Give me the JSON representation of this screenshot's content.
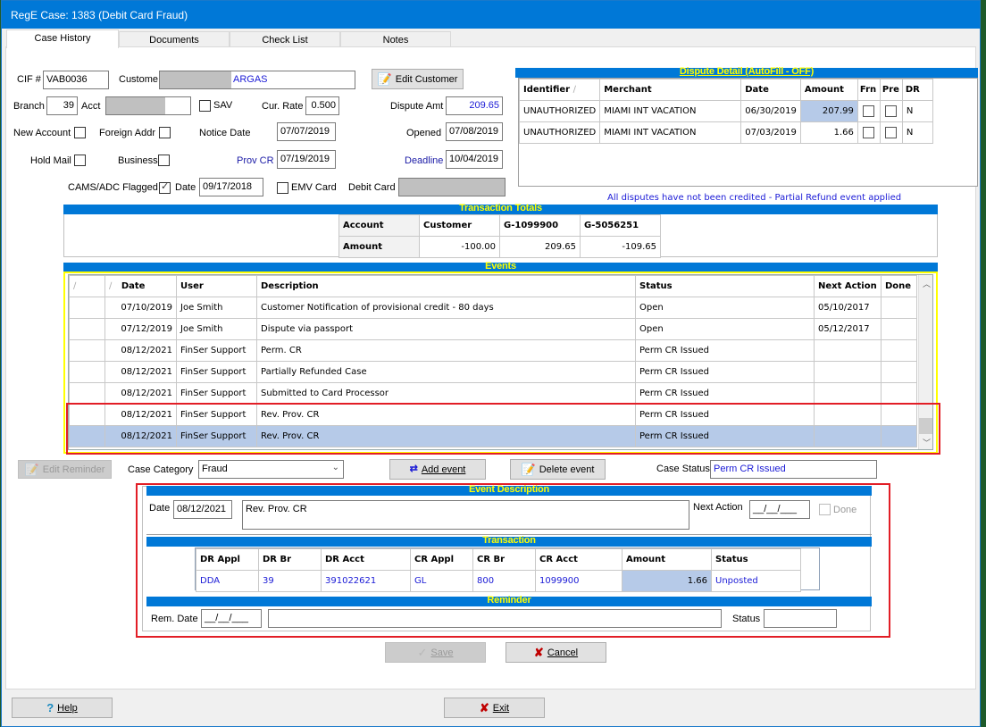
{
  "window": {
    "title": "RegE Case: 1383 (Debit Card Fraud)"
  },
  "tabs": [
    {
      "label": "Case History",
      "active": true
    },
    {
      "label": "Documents",
      "active": false
    },
    {
      "label": "Check List",
      "active": false
    },
    {
      "label": "Notes",
      "active": false
    }
  ],
  "case": {
    "cif_label": "CIF #",
    "cif": "VAB0036",
    "customer_label": "Custome",
    "customer_visible": "ARGAS",
    "edit_customer": "Edit Customer",
    "branch_label": "Branch",
    "branch": "39",
    "acct_label": "Acct",
    "sav_label": "SAV",
    "sav_checked": false,
    "cur_rate_label": "Cur. Rate",
    "cur_rate": "0.500",
    "dispute_amt_label": "Dispute Amt",
    "dispute_amt": "209.65",
    "new_account_label": "New Account",
    "new_account_checked": false,
    "foreign_addr_label": "Foreign Addr",
    "foreign_addr_checked": false,
    "notice_date_label": "Notice Date",
    "notice_date": "07/07/2019",
    "opened_label": "Opened",
    "opened": "07/08/2019",
    "hold_mail_label": "Hold Mail",
    "hold_mail_checked": false,
    "business_label": "Business",
    "business_checked": false,
    "prov_cr_label": "Prov CR",
    "prov_cr": "07/19/2019",
    "deadline_label": "Deadline",
    "deadline": "10/04/2019",
    "cams_label": "CAMS/ADC Flagged",
    "cams_checked": true,
    "date_label": "Date",
    "cams_date": "09/17/2018",
    "emv_label": "EMV Card",
    "emv_checked": false,
    "debit_card_label": "Debit Card"
  },
  "dispute_detail": {
    "title": "Dispute Detail (AutoFill - OFF)",
    "columns": [
      "Identifier",
      "Merchant",
      "Date",
      "Amount",
      "Frn",
      "Pre",
      "DR"
    ],
    "rows": [
      {
        "identifier": "UNAUTHORIZED",
        "merchant": "MIAMI INT VACATION",
        "date": "06/30/2019",
        "amount": "207.99",
        "frn": false,
        "pre": false,
        "dr": "N"
      },
      {
        "identifier": "UNAUTHORIZED",
        "merchant": "MIAMI INT VACATION",
        "date": "07/03/2019",
        "amount": "1.66",
        "frn": false,
        "pre": false,
        "dr": "N"
      }
    ],
    "note": "All disputes have not been credited - Partial Refund event applied"
  },
  "transaction_totals": {
    "title": "Transaction Totals",
    "columns": [
      "Account",
      "Customer",
      "G-1099900",
      "G-5056251"
    ],
    "row_label": "Amount",
    "values": [
      "-100.00",
      "209.65",
      "-109.65"
    ]
  },
  "events": {
    "title": "Events",
    "columns": [
      "",
      "Date",
      "User",
      "Description",
      "Status",
      "Next Action",
      "Done"
    ],
    "rows": [
      {
        "date": "07/10/2019",
        "user": "Joe Smith",
        "description": "Customer Notification of provisional credit - 80 days",
        "status": "Open",
        "next_action": "05/10/2017",
        "done": ""
      },
      {
        "date": "07/12/2019",
        "user": "Joe Smith",
        "description": "Dispute via passport",
        "status": "Open",
        "next_action": "05/12/2017",
        "done": ""
      },
      {
        "date": "08/12/2021",
        "user": "FinSer Support",
        "description": "Perm. CR",
        "status": "Perm CR Issued",
        "next_action": "",
        "done": ""
      },
      {
        "date": "08/12/2021",
        "user": "FinSer Support",
        "description": "Partially Refunded Case",
        "status": "Perm CR Issued",
        "next_action": "",
        "done": ""
      },
      {
        "date": "08/12/2021",
        "user": "FinSer Support",
        "description": "Submitted to Card Processor",
        "status": "Perm CR Issued",
        "next_action": "",
        "done": ""
      },
      {
        "date": "08/12/2021",
        "user": "FinSer Support",
        "description": "Rev. Prov. CR",
        "status": "Perm CR Issued",
        "next_action": "",
        "done": ""
      },
      {
        "date": "08/12/2021",
        "user": "FinSer Support",
        "description": "Rev. Prov. CR",
        "status": "Perm CR Issued",
        "next_action": "",
        "done": "",
        "selected": true
      }
    ]
  },
  "actions": {
    "edit_reminder": "Edit Reminder",
    "case_category_label": "Case Category",
    "case_category": "Fraud",
    "add_event": "Add event",
    "delete_event": "Delete event",
    "case_status_label": "Case Status",
    "case_status": "Perm CR Issued"
  },
  "event_description": {
    "title": "Event Description",
    "date_label": "Date",
    "date": "08/12/2021",
    "description": "Rev. Prov. CR",
    "next_action_label": "Next Action",
    "next_action": "__/__/___",
    "done_label": "Done",
    "done_checked": false
  },
  "transaction": {
    "title": "Transaction",
    "columns": [
      "DR Appl",
      "DR Br",
      "DR Acct",
      "CR Appl",
      "CR Br",
      "CR Acct",
      "Amount",
      "Status"
    ],
    "rows": [
      {
        "dr_appl": "DDA",
        "dr_br": "39",
        "dr_acct": "391022621",
        "cr_appl": "GL",
        "cr_br": "800",
        "cr_acct": "1099900",
        "amount": "1.66",
        "status": "Unposted"
      }
    ]
  },
  "reminder": {
    "title": "Reminder",
    "rem_date_label": "Rem. Date",
    "rem_date": "__/__/___",
    "text": "",
    "status_label": "Status",
    "status": ""
  },
  "footer": {
    "save": "Save",
    "cancel": "Cancel",
    "help": "Help",
    "exit": "Exit"
  },
  "colors": {
    "section_bar": "#0078d7",
    "section_text": "#ffff00",
    "highlight": "#e21e26",
    "selection": "#b6cae8"
  }
}
